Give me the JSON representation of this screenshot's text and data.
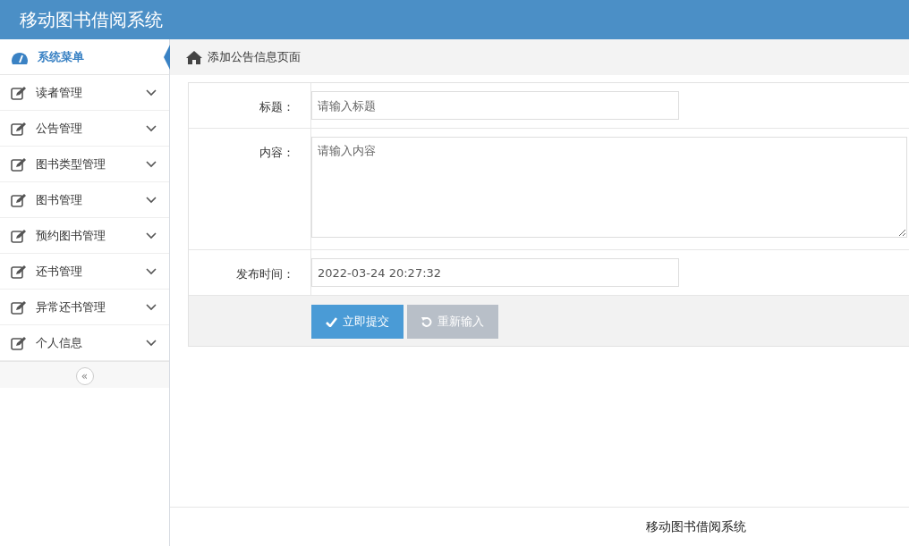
{
  "header": {
    "title": "移动图书借阅系统"
  },
  "sidebar": {
    "heading": "系统菜单",
    "items": [
      {
        "label": "读者管理",
        "expanded": false
      },
      {
        "label": "公告管理",
        "expanded": false
      },
      {
        "label": "图书类型管理",
        "expanded": false
      },
      {
        "label": "图书管理",
        "expanded": false
      },
      {
        "label": "预约图书管理",
        "expanded": false
      },
      {
        "label": "还书管理",
        "expanded": false
      },
      {
        "label": "异常还书管理",
        "expanded": false
      },
      {
        "label": "个人信息",
        "expanded": false
      }
    ],
    "collapse": "«"
  },
  "breadcrumb": "添加公告信息页面",
  "form": {
    "fields": [
      {
        "kind": "input",
        "label": "标题：",
        "placeholder": "请输入标题"
      },
      {
        "kind": "textarea",
        "label": "内容：",
        "placeholder": "请输入内容"
      },
      {
        "kind": "input",
        "label": "发布时间：",
        "value": "2022-03-24 20:27:32"
      }
    ],
    "buttons": [
      {
        "kind": "primary",
        "label": "立即提交"
      },
      {
        "kind": "reset",
        "label": "重新输入"
      }
    ]
  },
  "footer": "移动图书借阅系统"
}
